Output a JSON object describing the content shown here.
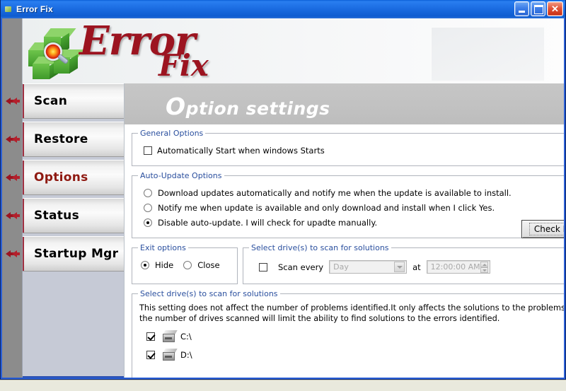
{
  "window": {
    "title": "Error Fix",
    "icon": "app-icon",
    "buttons": {
      "minimize": "minimize",
      "maximize": "maximize",
      "close": "close"
    }
  },
  "logo": {
    "word1": "Error",
    "word2": "Fix"
  },
  "sidebar": {
    "items": [
      {
        "label": "Scan",
        "active": false
      },
      {
        "label": "Restore",
        "active": false
      },
      {
        "label": "Options",
        "active": true
      },
      {
        "label": "Status",
        "active": false
      },
      {
        "label": "Startup Mgr",
        "active": false
      }
    ]
  },
  "banner": {
    "title_cap": "O",
    "title_rest": "ption settings"
  },
  "general_options": {
    "legend": "General Options",
    "auto_start": {
      "label": "Automatically Start when windows Starts",
      "checked": false
    }
  },
  "auto_update": {
    "legend": "Auto-Update Options",
    "options": [
      {
        "label": "Download updates automatically and notify me when the update is available to install.",
        "selected": false
      },
      {
        "label": "Notify me when update is available and only download and install  when I click Yes.",
        "selected": false
      },
      {
        "label": "Disable auto-update. I will check for upadte manually.",
        "selected": true
      }
    ],
    "check_now_button": "Check Now ..."
  },
  "exit_options": {
    "legend": "Exit options",
    "options": [
      {
        "label": "Hide",
        "selected": true
      },
      {
        "label": "Close",
        "selected": false
      }
    ]
  },
  "schedule": {
    "legend": "Select drive(s) to scan for solutions",
    "scan_every": {
      "label": "Scan every",
      "checked": false
    },
    "interval_value": "Day",
    "at_label": "at",
    "time_value": "12:00:00 AM"
  },
  "drives": {
    "legend": "Select drive(s) to scan for solutions",
    "description": "This setting does not affect the number of problems identified.It only affects the solutions to the problems. Limiting the number of drives scanned will limit the ability to find solutions to the errors identified.",
    "items": [
      {
        "label": "C:\\",
        "checked": true
      },
      {
        "label": "D:\\",
        "checked": true
      }
    ]
  },
  "colors": {
    "titlebar": "#1d6fe4",
    "accent_red": "#9c1420",
    "legend_blue": "#2a4f9e",
    "sidebar": "#c6cad6",
    "banner_gray": "#c2c2c2"
  }
}
